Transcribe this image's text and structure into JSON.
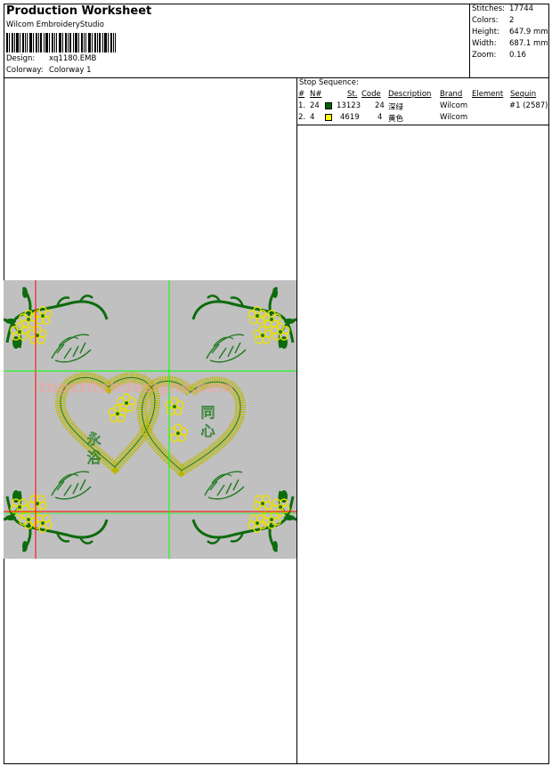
{
  "header": {
    "title": "Production Worksheet",
    "company": "Wilcom EmbroideryStudio",
    "design_label": "Design:",
    "design_value": "xq1180.EMB",
    "colorway_label": "Colorway:",
    "colorway_value": "Colorway 1"
  },
  "stats": [
    {
      "label": "Stitches:",
      "value": "17744"
    },
    {
      "label": "Colors:",
      "value": "2"
    },
    {
      "label": "Height:",
      "value": "647.9 mm"
    },
    {
      "label": "Width:",
      "value": "687.1 mm"
    },
    {
      "label": "Zoom:",
      "value": "0.16"
    }
  ],
  "stop_sequence": {
    "title": "Stop Sequence:",
    "columns": [
      "#",
      "N#",
      "St.",
      "Code",
      "Description",
      "Brand",
      "Element",
      "Sequin"
    ],
    "rows": [
      {
        "num": "1.",
        "n": "24",
        "color": "#006400",
        "st": "13123",
        "code": "24",
        "desc": "深绿",
        "brand": "Wilcom",
        "sequin": "#1 (2587)"
      },
      {
        "num": "2.",
        "n": "4",
        "color": "#ffff00",
        "st": "4619",
        "code": "4",
        "desc": "黄色",
        "brand": "Wilcom",
        "sequin": ""
      }
    ]
  },
  "design": {
    "heart_left_text": "永 浴",
    "heart_right_text": "同 心",
    "watermark": "topstitchdesigns.com"
  }
}
